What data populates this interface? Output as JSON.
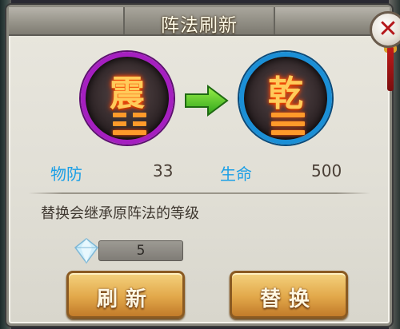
{
  "dialog": {
    "title": "阵法刷新",
    "close_icon": "close-icon"
  },
  "formation_from": {
    "glyph": "震",
    "stat_label": "物防",
    "stat_value": "33",
    "ring_color": "#a51fc0"
  },
  "formation_to": {
    "glyph": "乾",
    "stat_label": "生命",
    "stat_value": "500",
    "ring_color": "#1b8fd6"
  },
  "info_text": "替换会继承原阵法的等级",
  "cost": {
    "icon": "diamond-icon",
    "value": "5"
  },
  "buttons": {
    "refresh_label": "刷新",
    "replace_label": "替换"
  },
  "colors": {
    "stat_label": "#1b9fe6",
    "button": "#e2a84a",
    "close_x": "#b4161a"
  }
}
